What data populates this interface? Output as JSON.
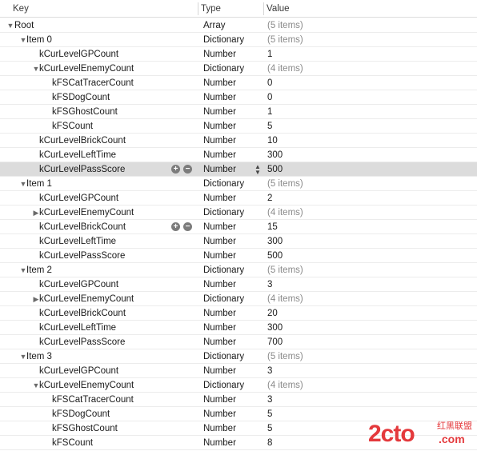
{
  "header": {
    "key": "Key",
    "type": "Type",
    "value": "Value"
  },
  "rows": [
    {
      "key": "Root",
      "type": "Array",
      "value": "(5 items)",
      "muted": true,
      "tri": "▼",
      "indent": 0
    },
    {
      "key": "Item 0",
      "type": "Dictionary",
      "value": "(5 items)",
      "muted": true,
      "tri": "▼",
      "indent": 1
    },
    {
      "key": "kCurLevelGPCount",
      "type": "Number",
      "value": "1",
      "indent": 2
    },
    {
      "key": "kCurLevelEnemyCount",
      "type": "Dictionary",
      "value": "(4 items)",
      "muted": true,
      "tri": "▼",
      "indent": 2
    },
    {
      "key": "kFSCatTracerCount",
      "type": "Number",
      "value": "0",
      "indent": 3
    },
    {
      "key": "kFSDogCount",
      "type": "Number",
      "value": "0",
      "indent": 3
    },
    {
      "key": "kFSGhostCount",
      "type": "Number",
      "value": "1",
      "indent": 3
    },
    {
      "key": "kFSCount",
      "type": "Number",
      "value": "5",
      "indent": 3
    },
    {
      "key": "kCurLevelBrickCount",
      "type": "Number",
      "value": "10",
      "indent": 2
    },
    {
      "key": "kCurLevelLeftTime",
      "type": "Number",
      "value": "300",
      "indent": 2
    },
    {
      "key": "kCurLevelPassScore",
      "type": "Number",
      "value": "500",
      "indent": 2,
      "selected": true,
      "controls": true,
      "stepper": true
    },
    {
      "key": "Item 1",
      "type": "Dictionary",
      "value": "(5 items)",
      "muted": true,
      "tri": "▼",
      "indent": 1
    },
    {
      "key": "kCurLevelGPCount",
      "type": "Number",
      "value": "2",
      "indent": 2
    },
    {
      "key": "kCurLevelEnemyCount",
      "type": "Dictionary",
      "value": "(4 items)",
      "muted": true,
      "tri": "▶",
      "indent": 2
    },
    {
      "key": "kCurLevelBrickCount",
      "type": "Number",
      "value": "15",
      "indent": 2,
      "controls": true
    },
    {
      "key": "kCurLevelLeftTime",
      "type": "Number",
      "value": "300",
      "indent": 2
    },
    {
      "key": "kCurLevelPassScore",
      "type": "Number",
      "value": "500",
      "indent": 2
    },
    {
      "key": "Item 2",
      "type": "Dictionary",
      "value": "(5 items)",
      "muted": true,
      "tri": "▼",
      "indent": 1
    },
    {
      "key": "kCurLevelGPCount",
      "type": "Number",
      "value": "3",
      "indent": 2
    },
    {
      "key": "kCurLevelEnemyCount",
      "type": "Dictionary",
      "value": "(4 items)",
      "muted": true,
      "tri": "▶",
      "indent": 2
    },
    {
      "key": "kCurLevelBrickCount",
      "type": "Number",
      "value": "20",
      "indent": 2
    },
    {
      "key": "kCurLevelLeftTime",
      "type": "Number",
      "value": "300",
      "indent": 2
    },
    {
      "key": "kCurLevelPassScore",
      "type": "Number",
      "value": "700",
      "indent": 2
    },
    {
      "key": "Item 3",
      "type": "Dictionary",
      "value": "(5 items)",
      "muted": true,
      "tri": "▼",
      "indent": 1
    },
    {
      "key": "kCurLevelGPCount",
      "type": "Number",
      "value": "3",
      "indent": 2
    },
    {
      "key": "kCurLevelEnemyCount",
      "type": "Dictionary",
      "value": "(4 items)",
      "muted": true,
      "tri": "▼",
      "indent": 2
    },
    {
      "key": "kFSCatTracerCount",
      "type": "Number",
      "value": "3",
      "indent": 3
    },
    {
      "key": "kFSDogCount",
      "type": "Number",
      "value": "5",
      "indent": 3
    },
    {
      "key": "kFSGhostCount",
      "type": "Number",
      "value": "5",
      "indent": 3
    },
    {
      "key": "kFSCount",
      "type": "Number",
      "value": "8",
      "indent": 3
    }
  ],
  "controls": {
    "add": "+",
    "remove": "−",
    "stepper_up": "▲",
    "stepper_down": "▼"
  },
  "watermark": {
    "logo": "2cto",
    "cn": "红黑联盟",
    "com": ".com"
  },
  "colors": {
    "selected_row": "#dcdcdc",
    "muted_text": "#8a8a8a",
    "watermark": "#e4393c"
  }
}
